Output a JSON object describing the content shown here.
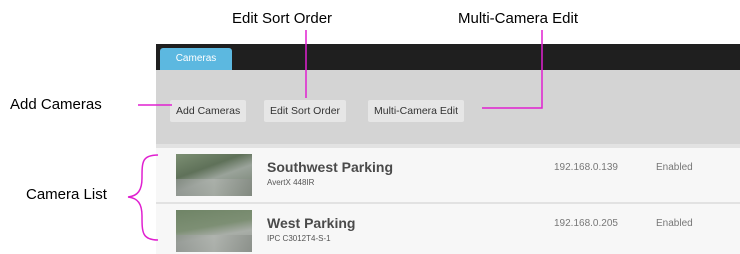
{
  "callouts": {
    "edit_sort_order": "Edit Sort Order",
    "multi_camera_edit": "Multi-Camera Edit",
    "add_cameras": "Add Cameras",
    "camera_list": "Camera List"
  },
  "tabs": [
    {
      "label": "Cameras"
    }
  ],
  "toolbar": {
    "add_cameras": "Add Cameras",
    "edit_sort_order": "Edit Sort Order",
    "multi_camera_edit": "Multi-Camera Edit"
  },
  "cameras": [
    {
      "name": "Southwest Parking",
      "model": "AvertX 448IR",
      "ip": "192.168.0.139",
      "status": "Enabled"
    },
    {
      "name": "West Parking",
      "model": "IPC C3012T4-S-1",
      "ip": "192.168.0.205",
      "status": "Enabled"
    }
  ],
  "colors": {
    "annotation": "#e020d0",
    "tab": "#5cb8e0",
    "titlebar": "#1f1f1f"
  }
}
